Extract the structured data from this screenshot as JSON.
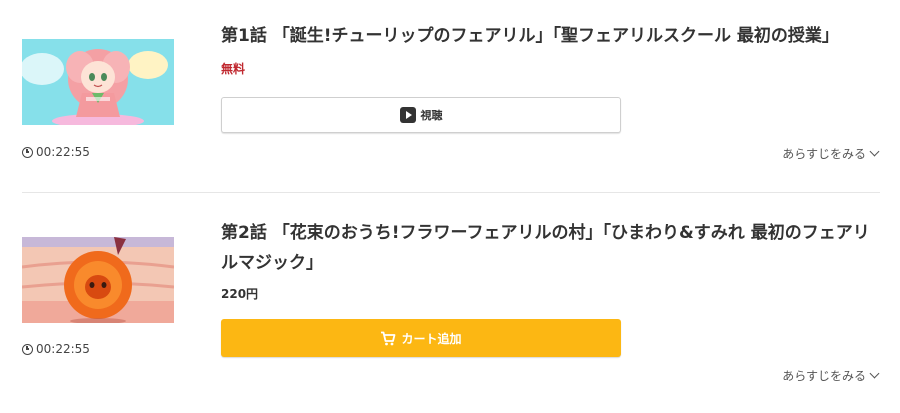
{
  "episodes": [
    {
      "title": "第1話 「誕生!チューリップのフェアリル」「聖フェアリルスクール 最初の授業」",
      "price": "無料",
      "duration": "00:22:55",
      "action_label": "視聴",
      "synopsis_label": "あらすじをみる",
      "thumbnail_icon": "anime-fairy-character-thumbnail"
    },
    {
      "title": "第2話 「花束のおうち!フラワーフェアリルの村」「ひまわり&すみれ 最初のフェアリルマジック」",
      "price": "220円",
      "duration": "00:22:55",
      "action_label": "カート追加",
      "synopsis_label": "あらすじをみる",
      "thumbnail_icon": "anime-flower-fairy-thumbnail"
    }
  ],
  "colors": {
    "free_price": "#c0282f",
    "cart_button": "#fcb713",
    "divider": "#e6e6e6"
  }
}
